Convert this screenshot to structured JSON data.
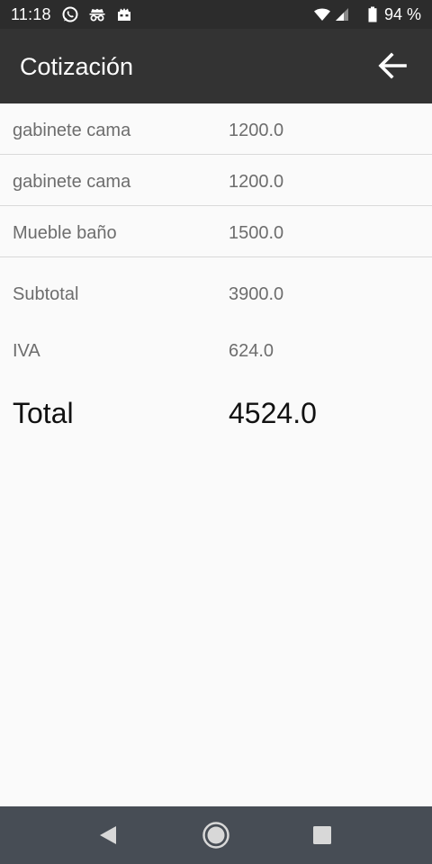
{
  "status_bar": {
    "time": "11:18",
    "battery_text": "94 %",
    "icons": [
      "whatsapp-icon",
      "incognito-icon",
      "notification-icon",
      "wifi-icon",
      "signal-icon",
      "battery-icon"
    ]
  },
  "app_bar": {
    "title": "Cotización",
    "back_icon": "arrow-back-icon"
  },
  "items": [
    {
      "name": "gabinete cama",
      "price": "1200.0"
    },
    {
      "name": "gabinete cama",
      "price": "1200.0"
    },
    {
      "name": "Mueble baño",
      "price": "1500.0"
    }
  ],
  "summary": {
    "subtotal_label": "Subtotal",
    "subtotal_value": "3900.0",
    "iva_label": "IVA",
    "iva_value": "624.0",
    "total_label": "Total",
    "total_value": "4524.0"
  },
  "nav_bar": {
    "icons": [
      "back-triangle-icon",
      "home-circle-icon",
      "recents-square-icon"
    ]
  },
  "colors": {
    "status_bar_bg": "#2c2c2c",
    "app_bar_bg": "#333333",
    "content_bg": "#fafafa",
    "nav_bar_bg": "#474d55",
    "secondary_text": "#6d6d6d",
    "primary_text": "#111111"
  }
}
